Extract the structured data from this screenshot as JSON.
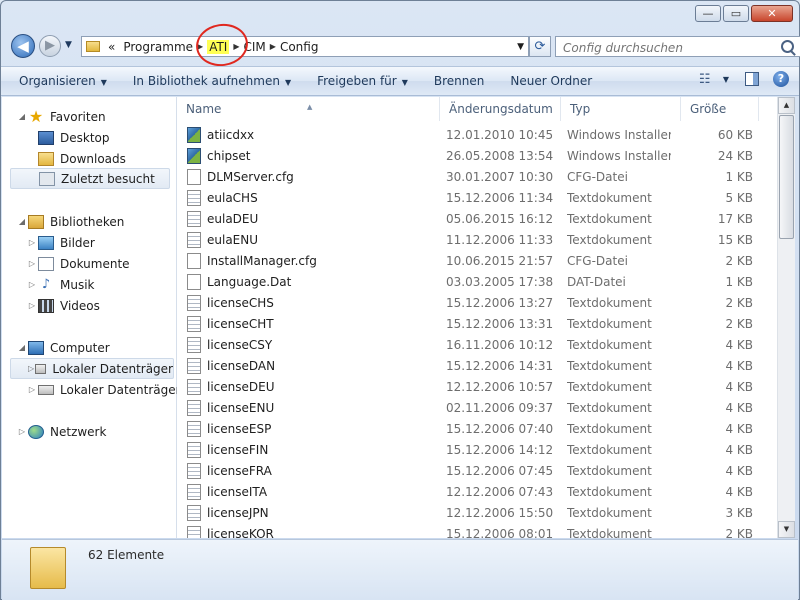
{
  "window": {
    "buttons": {
      "minimize": "—",
      "maximize": "▭",
      "close": "✕"
    }
  },
  "nav": {
    "back_glyph": "◀",
    "forward_glyph": "▶",
    "dropdown_glyph": "▼",
    "breadcrumb": {
      "overflow": "«",
      "items": [
        "Programme",
        "ATI",
        "CIM",
        "Config"
      ],
      "separator": "▶"
    },
    "address_dropdown": "▼",
    "refresh_glyph": "⟳",
    "search_placeholder": "Config durchsuchen"
  },
  "toolbar": {
    "organize": "Organisieren",
    "include_library": "In Bibliothek aufnehmen",
    "share": "Freigeben für",
    "burn": "Brennen",
    "new_folder": "Neuer Ordner",
    "dropdown_glyph": "▼",
    "view_glyph": "☷",
    "help_glyph": "?"
  },
  "navpane": {
    "favorites": "Favoriten",
    "desktop": "Desktop",
    "downloads": "Downloads",
    "recent": "Zuletzt besucht",
    "libraries": "Bibliotheken",
    "pictures": "Bilder",
    "documents": "Dokumente",
    "music": "Musik",
    "videos": "Videos",
    "computer": "Computer",
    "drive1": "Lokaler Datenträger",
    "drive2": "Lokaler Datenträger",
    "network": "Netzwerk",
    "expanded_glyph": "◢",
    "collapsed_glyph": "▷",
    "star_glyph": "★",
    "music_glyph": "♪"
  },
  "list": {
    "columns": {
      "name": "Name",
      "date": "Änderungsdatum",
      "type": "Typ",
      "size": "Größe"
    },
    "sort_glyph": "▲",
    "files": [
      {
        "name": "atiicdxx",
        "date": "12.01.2010 10:45",
        "type": "Windows Installer...",
        "size": "60 KB",
        "icon": "msi"
      },
      {
        "name": "chipset",
        "date": "26.05.2008 13:54",
        "type": "Windows Installer...",
        "size": "24 KB",
        "icon": "msi"
      },
      {
        "name": "DLMServer.cfg",
        "date": "30.01.2007 10:30",
        "type": "CFG-Datei",
        "size": "1 KB",
        "icon": "file"
      },
      {
        "name": "eulaCHS",
        "date": "15.12.2006 11:34",
        "type": "Textdokument",
        "size": "5 KB",
        "icon": "txt"
      },
      {
        "name": "eulaDEU",
        "date": "05.06.2015 16:12",
        "type": "Textdokument",
        "size": "17 KB",
        "icon": "txt"
      },
      {
        "name": "eulaENU",
        "date": "11.12.2006 11:33",
        "type": "Textdokument",
        "size": "15 KB",
        "icon": "txt"
      },
      {
        "name": "InstallManager.cfg",
        "date": "10.06.2015 21:57",
        "type": "CFG-Datei",
        "size": "2 KB",
        "icon": "file"
      },
      {
        "name": "Language.Dat",
        "date": "03.03.2005 17:38",
        "type": "DAT-Datei",
        "size": "1 KB",
        "icon": "file"
      },
      {
        "name": "licenseCHS",
        "date": "15.12.2006 13:27",
        "type": "Textdokument",
        "size": "2 KB",
        "icon": "txt"
      },
      {
        "name": "licenseCHT",
        "date": "15.12.2006 13:31",
        "type": "Textdokument",
        "size": "2 KB",
        "icon": "txt"
      },
      {
        "name": "licenseCSY",
        "date": "16.11.2006 10:12",
        "type": "Textdokument",
        "size": "4 KB",
        "icon": "txt"
      },
      {
        "name": "licenseDAN",
        "date": "15.12.2006 14:31",
        "type": "Textdokument",
        "size": "4 KB",
        "icon": "txt"
      },
      {
        "name": "licenseDEU",
        "date": "12.12.2006 10:57",
        "type": "Textdokument",
        "size": "4 KB",
        "icon": "txt"
      },
      {
        "name": "licenseENU",
        "date": "02.11.2006 09:37",
        "type": "Textdokument",
        "size": "4 KB",
        "icon": "txt"
      },
      {
        "name": "licenseESP",
        "date": "15.12.2006 07:40",
        "type": "Textdokument",
        "size": "4 KB",
        "icon": "txt"
      },
      {
        "name": "licenseFIN",
        "date": "15.12.2006 14:12",
        "type": "Textdokument",
        "size": "4 KB",
        "icon": "txt"
      },
      {
        "name": "licenseFRA",
        "date": "15.12.2006 07:45",
        "type": "Textdokument",
        "size": "4 KB",
        "icon": "txt"
      },
      {
        "name": "licenseITA",
        "date": "12.12.2006 07:43",
        "type": "Textdokument",
        "size": "4 KB",
        "icon": "txt"
      },
      {
        "name": "licenseJPN",
        "date": "12.12.2006 15:50",
        "type": "Textdokument",
        "size": "3 KB",
        "icon": "txt"
      },
      {
        "name": "licenseKOR",
        "date": "15.12.2006 08:01",
        "type": "Textdokument",
        "size": "2 KB",
        "icon": "txt"
      }
    ]
  },
  "scrollbar": {
    "up_glyph": "▲",
    "down_glyph": "▼"
  },
  "details": {
    "count": "62 Elemente"
  }
}
